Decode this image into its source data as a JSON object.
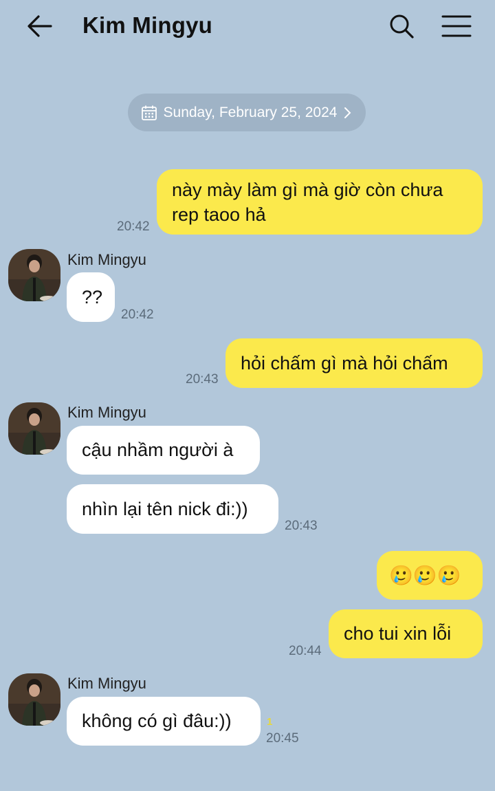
{
  "header": {
    "title": "Kim Mingyu",
    "back_icon": "arrow-left-icon",
    "search_icon": "search-icon",
    "menu_icon": "hamburger-menu-icon"
  },
  "date_divider": {
    "label": "Sunday, February 25, 2024",
    "icon": "calendar-icon"
  },
  "colors": {
    "background": "#b2c7da",
    "my_bubble": "#fbe94c",
    "their_bubble": "#ffffff",
    "date_pill": "#9fb3c6"
  },
  "messages": [
    {
      "from": "me",
      "lines": [
        "này mày làm gì mà giờ còn chưa",
        "rep taoo hả"
      ],
      "time": "20:42"
    },
    {
      "from": "Kim Mingyu",
      "sender": "Kim Mingyu",
      "text": "??",
      "time": "20:42"
    },
    {
      "from": "me",
      "text": "hỏi chấm gì mà hỏi chấm",
      "time": "20:43"
    },
    {
      "from": "Kim Mingyu",
      "sender": "Kim Mingyu",
      "text": "cậu nhầm người à"
    },
    {
      "from": "Kim Mingyu",
      "text": "nhìn lại tên nick đi:))",
      "time": "20:43"
    },
    {
      "from": "me",
      "text": "🥲🥲🥲"
    },
    {
      "from": "me",
      "text": "cho tui xin lỗi",
      "time": "20:44"
    },
    {
      "from": "Kim Mingyu",
      "sender": "Kim Mingyu",
      "text": "không có gì đâu:))",
      "time": "20:45",
      "unread": "1"
    }
  ]
}
